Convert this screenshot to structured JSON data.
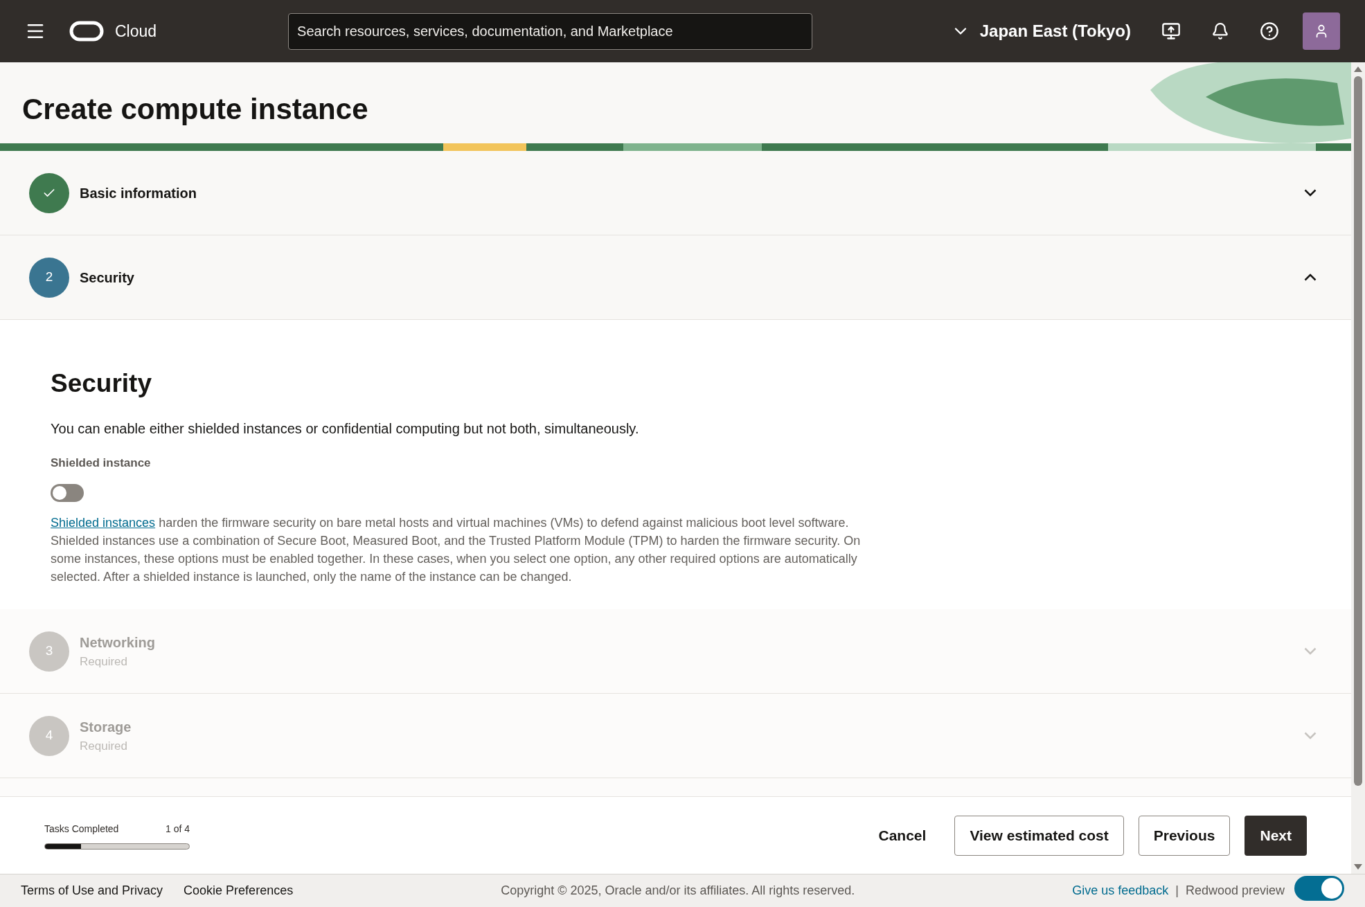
{
  "top_bar": {
    "brand": "Cloud",
    "search": {
      "placeholder": "Search resources, services, documentation, and Marketplace"
    },
    "region": "Japan East (Tokyo)"
  },
  "page_title": "Create compute instance",
  "steps": [
    {
      "kind": "completed",
      "label": "Basic information",
      "expanded": false
    },
    {
      "kind": "active",
      "number": "2",
      "label": "Security",
      "expanded": true
    },
    {
      "kind": "pending",
      "number": "3",
      "label": "Networking",
      "subtitle": "Required",
      "expanded": false
    },
    {
      "kind": "pending",
      "number": "4",
      "label": "Storage",
      "subtitle": "Required",
      "expanded": false
    }
  ],
  "security_panel": {
    "heading": "Security",
    "intro": "You can enable either shielded instances or confidential computing but not both, simultaneously.",
    "toggle_label": "Shielded instance",
    "toggle_on": false,
    "link": "Shielded instances",
    "description": "harden the firmware security on bare metal hosts and virtual machines (VMs) to defend against malicious boot level software. Shielded instances use a combination of Secure Boot, Measured Boot, and the Trusted Platform Module (TPM) to harden the firmware security. On some instances, these options must be enabled together. In these cases, when you select one option, any other required options are automatically selected. After a shielded instance is launched, only the name of the instance can be changed."
  },
  "progress": {
    "label": "Tasks Completed",
    "count": "1 of 4",
    "level": 0.25
  },
  "actions": [
    {
      "kind": "text",
      "label": "Cancel"
    },
    {
      "kind": "outline",
      "label": "View estimated cost"
    },
    {
      "kind": "outline",
      "label": "Previous"
    },
    {
      "kind": "primary",
      "label": "Next"
    }
  ],
  "footer": {
    "links": [
      "Terms of Use and Privacy",
      "Cookie Preferences"
    ],
    "copyright": "Copyright © 2025, Oracle and/or its affiliates. All rights reserved.",
    "feedback": "Give us feedback",
    "separator": "|",
    "preview_label": "Redwood preview",
    "preview_on": true
  }
}
